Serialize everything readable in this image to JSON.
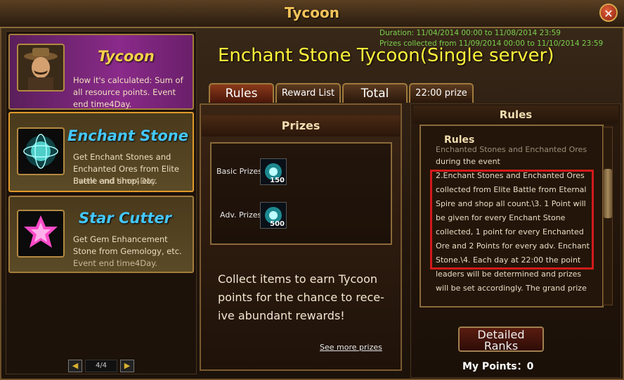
{
  "window": {
    "title": "Tycoon",
    "close_label": "✕"
  },
  "left_cards": [
    {
      "name": "Tycoon",
      "desc": "How it's calculated: Sum of all resource points. Event end time4Day.",
      "icon": "tycoon-portrait-icon"
    },
    {
      "name": "Enchant Stone",
      "desc": "Get Enchant Stones and Enchanted Ores from Elite Battle and shop, etc.",
      "desc_overlay": "Event end time4Day.",
      "icon": "enchant-stone-icon"
    },
    {
      "name": "Star Cutter",
      "desc": "Get Gem Enhancement Stone from Gemology, etc.",
      "desc_overlay": "Event end time4Day.",
      "icon": "star-gem-icon"
    }
  ],
  "pager": {
    "prev": "◀",
    "next": "▶",
    "page": "4/4"
  },
  "event": {
    "duration": "Duration: 11/04/2014 00:00 to 11/08/2014 23:59",
    "prizes_collected": "Prizes collected from 11/09/2014 00:00 to 11/10/2014 23:59",
    "title": "Enchant Stone Tycoon(Single server)"
  },
  "tabs": [
    "Rules",
    "Reward List",
    "Total",
    "22:00 prize"
  ],
  "prizes_panel": {
    "header": "Prizes",
    "basic_label": "Basic Prizes",
    "basic_count": "150",
    "adv_label": "Adv. Prizes",
    "adv_count": "500",
    "collect_text": "Collect items to earn Tycoon points for the chance to rece- ive abundant rewards!",
    "see_more": "See more prizes"
  },
  "rules_panel": {
    "header": "Rules",
    "subheader": "Rules",
    "lines": [
      "Enchanted Stones and Enchanted Ores",
      "during the event",
      "2.Enchant Stones and Enchanted Ores",
      "collected from Elite Battle from Eternal",
      "Spire and shop all count.\\3. 1 Point will",
      "be given for every Enchant Stone",
      "collected, 1 point for every Enchanted",
      "Ore and 2 Points for every adv. Enchant",
      "Stone.\\4. Each day at 22:00 the point",
      "leaders will be determined and prizes",
      "will be set accordingly. The grand prize"
    ],
    "detailed_line1": "Detailed",
    "detailed_line2": "Ranks",
    "my_points": "My Points：0"
  }
}
